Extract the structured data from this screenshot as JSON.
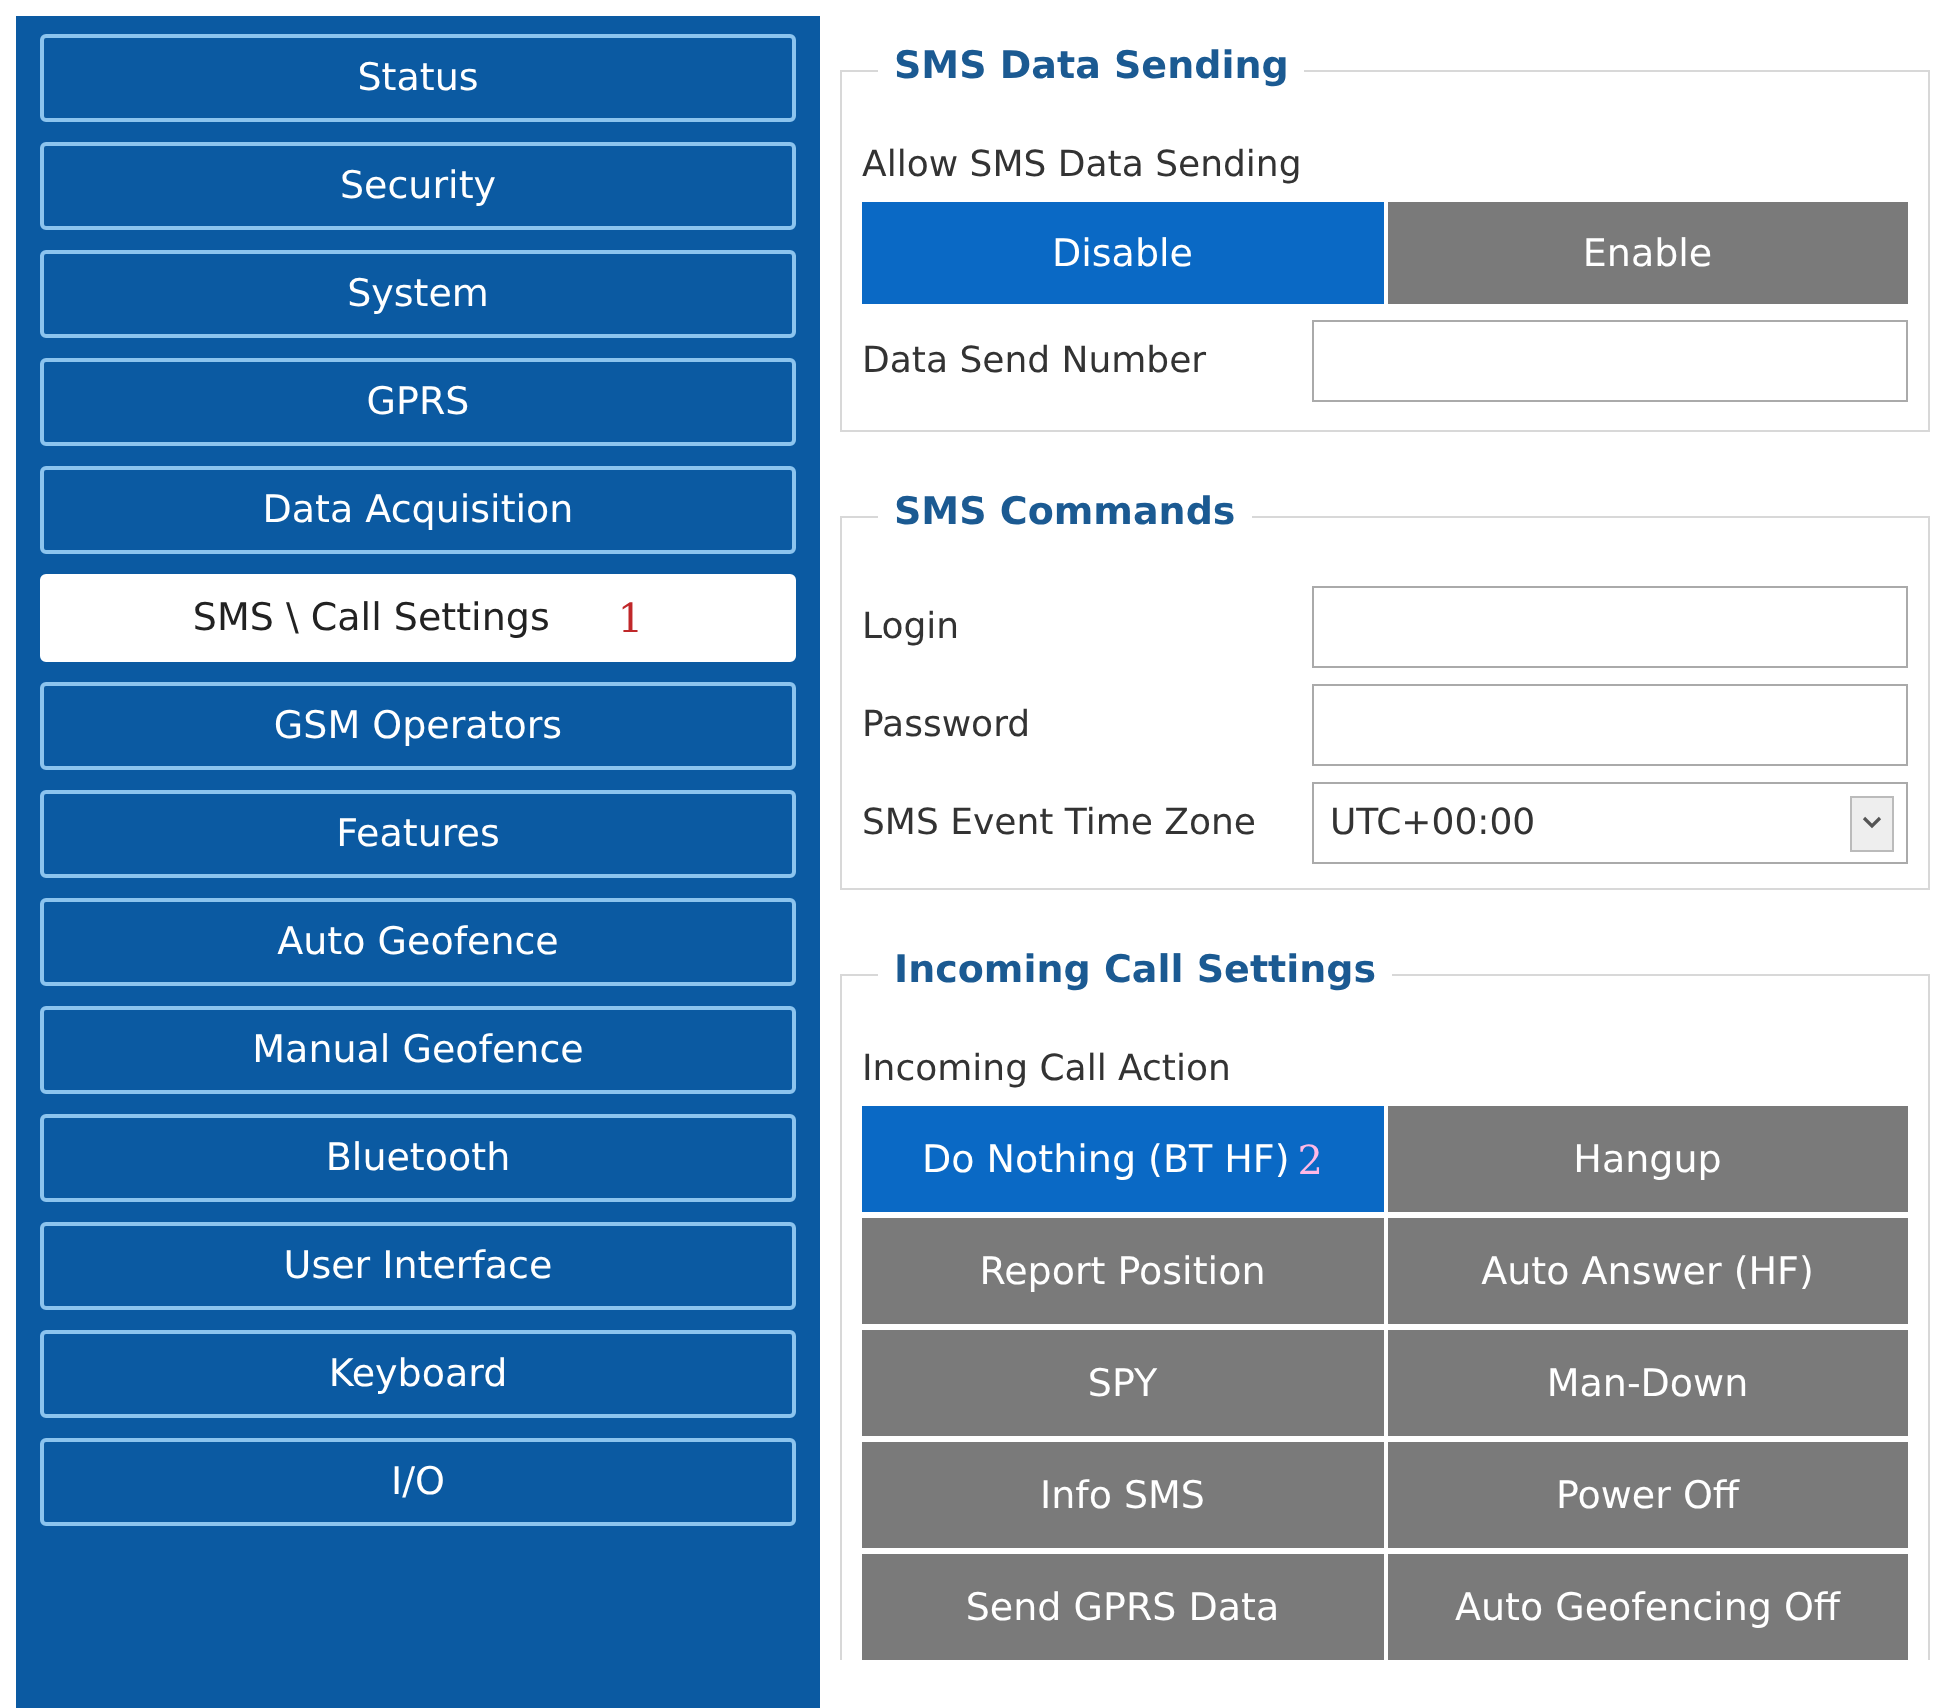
{
  "sidebar": {
    "items": [
      {
        "label": "Status",
        "selected": false
      },
      {
        "label": "Security",
        "selected": false
      },
      {
        "label": "System",
        "selected": false
      },
      {
        "label": "GPRS",
        "selected": false
      },
      {
        "label": "Data Acquisition",
        "selected": false
      },
      {
        "label": "SMS \\ Call Settings",
        "selected": true,
        "marker": "1"
      },
      {
        "label": "GSM Operators",
        "selected": false
      },
      {
        "label": "Features",
        "selected": false
      },
      {
        "label": "Auto Geofence",
        "selected": false
      },
      {
        "label": "Manual Geofence",
        "selected": false
      },
      {
        "label": "Bluetooth",
        "selected": false
      },
      {
        "label": "User Interface",
        "selected": false
      },
      {
        "label": "Keyboard",
        "selected": false
      },
      {
        "label": "I/O",
        "selected": false
      }
    ]
  },
  "sms_data_sending": {
    "title": "SMS Data Sending",
    "allow_label": "Allow SMS Data Sending",
    "options": [
      {
        "label": "Disable",
        "selected": true
      },
      {
        "label": "Enable",
        "selected": false
      }
    ],
    "data_send_number": {
      "label": "Data Send Number"
    }
  },
  "sms_commands": {
    "title": "SMS Commands",
    "login": {
      "label": "Login"
    },
    "password": {
      "label": "Password"
    },
    "time_zone": {
      "label": "SMS Event Time Zone",
      "value": "UTC+00:00"
    }
  },
  "incoming_call_settings": {
    "title": "Incoming Call Settings",
    "action_label": "Incoming Call Action",
    "actions": [
      {
        "label": "Do Nothing (BT HF)",
        "selected": true,
        "marker": "2"
      },
      {
        "label": "Hangup",
        "selected": false
      },
      {
        "label": "Report Position",
        "selected": false
      },
      {
        "label": "Auto Answer (HF)",
        "selected": false
      },
      {
        "label": "SPY",
        "selected": false
      },
      {
        "label": "Man-Down",
        "selected": false
      },
      {
        "label": "Info SMS",
        "selected": false
      },
      {
        "label": "Power Off",
        "selected": false
      },
      {
        "label": "Send GPRS Data",
        "selected": false
      },
      {
        "label": "Auto Geofencing Off",
        "selected": false
      }
    ]
  }
}
